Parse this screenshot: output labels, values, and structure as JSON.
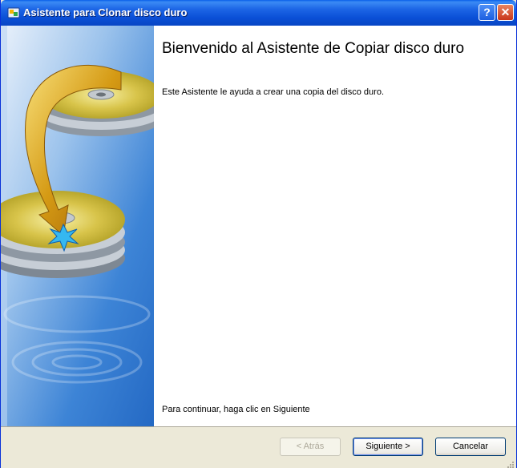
{
  "window": {
    "title": "Asistente para Clonar disco duro",
    "help_label": "?",
    "close_label": "✕"
  },
  "content": {
    "heading": "Bienvenido al Asistente de Copiar disco duro",
    "description": "Este Asistente le ayuda a crear una copia del disco duro.",
    "continue_hint": "Para continuar, haga clic en Siguiente"
  },
  "buttons": {
    "back": "< Atrás",
    "next": "Siguiente >",
    "cancel": "Cancelar"
  },
  "colors": {
    "titlebar": "#0a4fd6",
    "dialog_face": "#ece9d8",
    "sidebar_blue": "#2e7bd8"
  },
  "icons": [
    "app-icon",
    "help-icon",
    "close-icon",
    "clone-disk-illustration",
    "resize-grip-icon"
  ]
}
